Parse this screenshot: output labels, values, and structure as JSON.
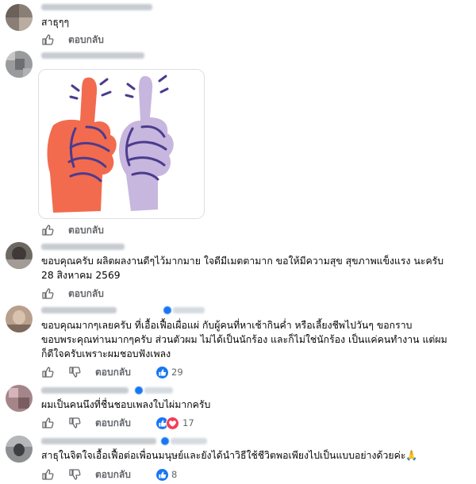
{
  "comments": [
    {
      "text_lines": [
        "สาธุๆๆ"
      ]
    },
    {
      "text_lines": []
    },
    {
      "text_lines": [
        "ขอบคุณครับ ผลิตผลงานดีๆไว้มากมาย ใจดีมีเมตตามาก ขอให้มีความสุข สุขภาพแข็งแรง นะครับ",
        "28 สิงหาคม 2569"
      ]
    },
    {
      "text_lines": [
        "ขอบคุณมากๆเลยครับ ที่เอื้อเฟื้อเผื่อแผ่ กับผู้คนที่หาเช้ากินค่ำ หรือเลี้ยงชีพไปวันๆ ขอกราบ",
        "ขอบพระคุณท่านมากๆครับ ส่วนตัวผม ไม่ได้เป็นนักร้อง และก็ไม่ใช่นักร้อง เป็นแค่คนทำงาน แต่ผม",
        "ก็ดีใจครับเพราะผมชอบฟังเพลง"
      ],
      "reactions": "29"
    },
    {
      "text_lines": [
        "ผมเป็นคนนึงที่ชื่นชอบเพลงใบไผ่มากครับ"
      ],
      "reactions": "17"
    },
    {
      "text_lines": [
        "สาธุในจิตใจเอื้อเฟื้อต่อเพื่อนมนุษย์และยังได้นำวิธีใช้ชีวิตพอเพียงไปเป็นแบบอย่างด้วยค่ะ🙏"
      ],
      "reactions": "8"
    }
  ],
  "actions": {
    "reply_label": "ตอบกลับ"
  },
  "icons": {
    "like": "thumbs-up-icon",
    "dislike": "thumbs-down-icon"
  },
  "colors": {
    "like_blue": "#1877f2",
    "love_red": "#f33e58",
    "orange_thumb": "#f26b4e",
    "purple_thumb": "#c7b6dd"
  }
}
